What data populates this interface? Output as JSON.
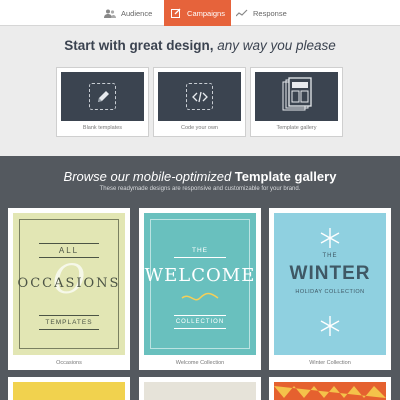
{
  "tabs": [
    {
      "label": "Audience",
      "icon": "people-icon",
      "active": false
    },
    {
      "label": "Campaigns",
      "icon": "edit-icon",
      "active": true
    },
    {
      "label": "Response",
      "icon": "trend-icon",
      "active": false
    }
  ],
  "design": {
    "title_bold": "Start with great design,",
    "title_italic": "any way you please",
    "options": [
      {
        "label": "Blank templates",
        "icon": "pencil-icon"
      },
      {
        "label": "Code your own",
        "icon": "code-icon"
      },
      {
        "label": "Template gallery",
        "icon": "templates-icon"
      }
    ]
  },
  "gallery": {
    "title_italic": "Browse our mobile-optimized",
    "title_bold": "Template gallery",
    "subtitle": "These readymade designs are responsive and customizable for your brand.",
    "cards": [
      {
        "caption": "Occasions",
        "art": {
          "top": "ALL",
          "big": "OCCASIONS",
          "bottom": "TEMPLATES"
        }
      },
      {
        "caption": "Welcome Collection",
        "art": {
          "top": "THE",
          "big": "WELCOME",
          "bottom": "COLLECTION"
        }
      },
      {
        "caption": "Winter Collection",
        "art": {
          "top": "THE",
          "big": "WINTER",
          "bottom": "HOLIDAY COLLECTION"
        }
      }
    ]
  },
  "colors": {
    "accent": "#e6633b",
    "dark": "#3b4450",
    "gallery_bg": "#54595f"
  }
}
